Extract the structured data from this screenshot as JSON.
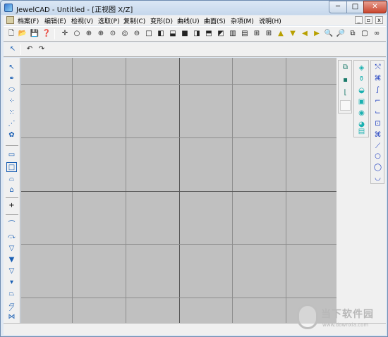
{
  "window": {
    "title": "JewelCAD - Untitled - [正视图 X/Z]",
    "minimize_glyph": "─",
    "maximize_glyph": "□",
    "close_glyph": "✕"
  },
  "menubar": {
    "items": [
      {
        "label": "档案(F)"
      },
      {
        "label": "编辑(E)"
      },
      {
        "label": "检视(V)"
      },
      {
        "label": "选取(P)"
      },
      {
        "label": "复制(C)"
      },
      {
        "label": "变形(D)"
      },
      {
        "label": "曲线(U)"
      },
      {
        "label": "曲面(S)"
      },
      {
        "label": "杂项(M)"
      },
      {
        "label": "说明(H)"
      }
    ],
    "mdi_minimize": "_",
    "mdi_restore": "▫",
    "mdi_close": "x"
  },
  "toolbar1": {
    "icons": [
      {
        "name": "new-file-icon",
        "glyph": "🗋"
      },
      {
        "name": "open-folder-icon",
        "glyph": "📂"
      },
      {
        "name": "save-icon",
        "glyph": "💾"
      },
      {
        "name": "help-pointer-icon",
        "glyph": "❓"
      },
      {
        "name": "crosshair-icon",
        "glyph": "✛"
      },
      {
        "name": "circle-icon",
        "glyph": "○"
      },
      {
        "name": "circle-plus-icon",
        "glyph": "⊕"
      },
      {
        "name": "circle-target-icon",
        "glyph": "⊕"
      },
      {
        "name": "circle-dot-icon",
        "glyph": "⊙"
      },
      {
        "name": "circle-filled-icon",
        "glyph": "◎"
      },
      {
        "name": "circle-minus-icon",
        "glyph": "⊖"
      },
      {
        "name": "circle-half-icon",
        "glyph": "◔"
      },
      {
        "name": "square-icon",
        "glyph": "□"
      },
      {
        "name": "square-left-icon",
        "glyph": "◧"
      },
      {
        "name": "square-bottom-icon",
        "glyph": "⬓"
      },
      {
        "name": "square-filled-icon",
        "glyph": "■"
      },
      {
        "name": "square-right-icon",
        "glyph": "◨"
      },
      {
        "name": "square-top-icon",
        "glyph": "⬒"
      },
      {
        "name": "square-corner-icon",
        "glyph": "◩"
      },
      {
        "name": "columns-icon",
        "glyph": "▥"
      },
      {
        "name": "rows-icon",
        "glyph": "▤"
      },
      {
        "name": "grid-icon",
        "glyph": "⊞"
      },
      {
        "name": "grid-bold-icon",
        "glyph": "⊞"
      },
      {
        "name": "triangle-up-icon",
        "glyph": "▲"
      },
      {
        "name": "triangle-down-icon",
        "glyph": "▼"
      },
      {
        "name": "triangle-left-icon",
        "glyph": "◀"
      },
      {
        "name": "triangle-right-icon",
        "glyph": "▶"
      },
      {
        "name": "zoom-in-icon",
        "glyph": "🔍"
      },
      {
        "name": "zoom-out-icon",
        "glyph": "🔎"
      },
      {
        "name": "zoom-window-icon",
        "glyph": "⧉"
      },
      {
        "name": "frame-icon",
        "glyph": "▢"
      },
      {
        "name": "binoculars-icon",
        "glyph": "∞"
      }
    ]
  },
  "toolbar2": {
    "icons": [
      {
        "name": "select-arrow-icon",
        "glyph": "↖"
      },
      {
        "name": "undo-icon",
        "glyph": "↶"
      },
      {
        "name": "redo-icon",
        "glyph": "↷"
      }
    ]
  },
  "left_toolbar": {
    "icons": [
      {
        "name": "select-pointer-icon",
        "glyph": "↖"
      },
      {
        "name": "select-pair-icon",
        "glyph": "⚭"
      },
      {
        "name": "select-ellipse-icon",
        "glyph": "⬭"
      },
      {
        "name": "select-nodes-icon",
        "glyph": "⁘"
      },
      {
        "name": "select-group-icon",
        "glyph": "⁙"
      },
      {
        "name": "select-chain-icon",
        "glyph": "⋰"
      },
      {
        "name": "select-gear-icon",
        "glyph": "✿"
      },
      {
        "name": "small-rect-icon",
        "glyph": "▭"
      },
      {
        "name": "rect-outline-icon",
        "glyph": "□"
      },
      {
        "name": "half-dome-icon",
        "glyph": "⌓"
      },
      {
        "name": "dome-rect-icon",
        "glyph": "⌂"
      },
      {
        "name": "move-point-icon",
        "glyph": "+"
      },
      {
        "name": "arch-icon",
        "glyph": "⌒"
      },
      {
        "name": "arch-arrow-icon",
        "glyph": "⤼"
      },
      {
        "name": "v-shape-icon",
        "glyph": "▽"
      },
      {
        "name": "v-bold-icon",
        "glyph": "▼"
      },
      {
        "name": "v-small-icon",
        "glyph": "▽"
      },
      {
        "name": "v-filled-icon",
        "glyph": "▾"
      },
      {
        "name": "trapezoid-icon",
        "glyph": "⏢"
      },
      {
        "name": "parallelogram-icon",
        "glyph": "▱"
      },
      {
        "name": "slash-icon",
        "glyph": "⟋"
      },
      {
        "name": "bowtie-icon",
        "glyph": "⋈"
      }
    ]
  },
  "right_toolbar_1": {
    "icons": [
      {
        "name": "layers-icon",
        "glyph": "⧉"
      },
      {
        "name": "small-square-icon",
        "glyph": "▪"
      },
      {
        "name": "corner-icon",
        "glyph": "⌊"
      },
      {
        "name": "blank-icon",
        "glyph": " "
      }
    ]
  },
  "right_toolbar_2": {
    "icons": [
      {
        "name": "gem-blade-icon",
        "glyph": "◈"
      },
      {
        "name": "gem-bottle-icon",
        "glyph": "⚱"
      },
      {
        "name": "gem-fish-icon",
        "glyph": "◒"
      },
      {
        "name": "gem-box-icon",
        "glyph": "▣"
      },
      {
        "name": "gem-round-icon",
        "glyph": "◉"
      },
      {
        "name": "gem-pie-icon",
        "glyph": "◕"
      },
      {
        "name": "gem-stack-icon",
        "glyph": "▤"
      }
    ]
  },
  "right_toolbar_3": {
    "icons": [
      {
        "name": "curve-x-icon",
        "glyph": "⤲"
      },
      {
        "name": "curve-nodes-icon",
        "glyph": "⌘"
      },
      {
        "name": "curve-s-icon",
        "glyph": "∫"
      },
      {
        "name": "curve-corner-icon",
        "glyph": "⌐"
      },
      {
        "name": "curve-step-icon",
        "glyph": "⌙"
      },
      {
        "name": "curve-box-icon",
        "glyph": "⊡"
      },
      {
        "name": "curve-cross-icon",
        "glyph": "⌘"
      },
      {
        "name": "curve-line-icon",
        "glyph": "⟋"
      },
      {
        "name": "curve-circle-icon",
        "glyph": "○"
      },
      {
        "name": "curve-circle2-icon",
        "glyph": "◯"
      },
      {
        "name": "curve-arc-icon",
        "glyph": "◡"
      }
    ]
  },
  "watermark": {
    "text": "当下软件园",
    "url": "www.downxia.com"
  }
}
